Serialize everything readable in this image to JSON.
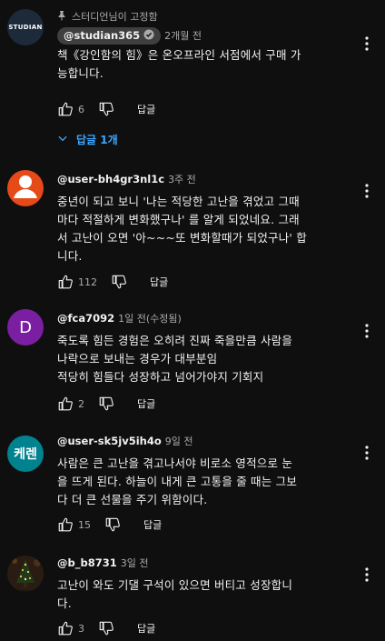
{
  "comments": [
    {
      "pinned_label": "스터디언님이 고정함",
      "avatar_text": "STUDIAN",
      "author": "@studian365",
      "time": "2개월 전",
      "text": "책《강인함의 힘》은 온오프라인 서점에서 구매 가\n능합니다.",
      "likes": "6",
      "reply_label": "답글",
      "replies_label": "답글 1개"
    },
    {
      "author": "@user-bh4gr3nl1c",
      "time": "3주 전",
      "text": "중년이 되고 보니 '나는 적당한 고난을 겪었고 그때\n마다 적절하게 변화했구나' 를 알게 되었네요. 그래\n서 고난이 오면 '아~~~또 변화할때가 되었구나' 합\n니다.",
      "likes": "112",
      "reply_label": "답글"
    },
    {
      "avatar_text": "D",
      "author": "@fca7092",
      "time": "1일 전(수정됨)",
      "text": "죽도록 힘든 경험은 오히려 진짜 죽을만큼 사람을\n나락으로 보내는 경우가 대부분임\n적당히 힘들다 성장하고 넘어가야지 기회지",
      "likes": "2",
      "reply_label": "답글"
    },
    {
      "avatar_text": "케렌",
      "author": "@user-sk5jv5ih4o",
      "time": "9일 전",
      "text": "사람은 큰 고난을 겪고나서야 비로소 영적으로 눈\n을 뜨게 된다. 하늘이 내게 큰 고통을 줄 때는 그보\n다 더 큰 선물을 주기 위함이다.",
      "likes": "15",
      "reply_label": "답글"
    },
    {
      "author": "@b_b8731",
      "time": "3일 전",
      "text": "고난이 와도 기댈 구석이 있으면 버티고 성장합니\n다.",
      "likes": "3",
      "reply_label": "답글"
    }
  ],
  "colors": {
    "background": "#0f0f0f",
    "link_blue": "#3ea6ff",
    "avatar_studian": "#1c2a3a",
    "avatar_default": "#e64a19",
    "avatar_d": "#7b1fa2",
    "avatar_keren": "#00838f"
  }
}
